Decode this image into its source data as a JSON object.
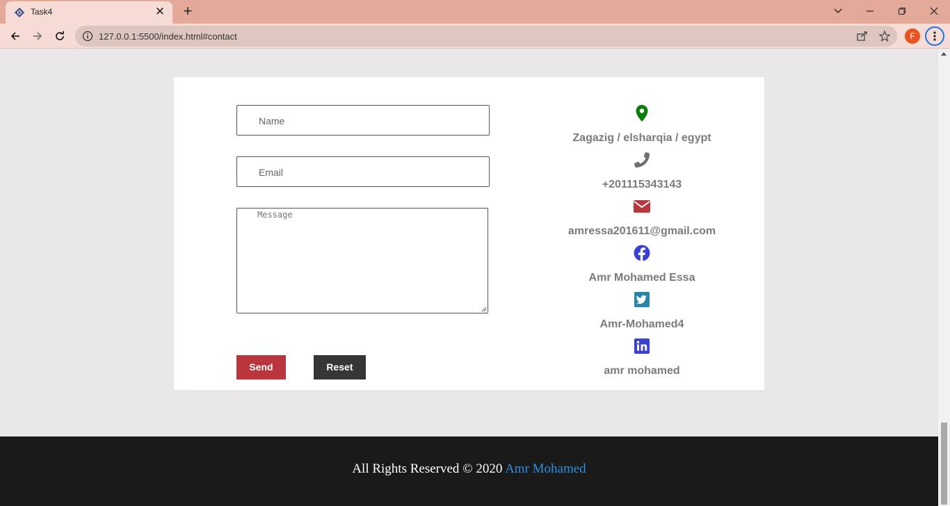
{
  "browser": {
    "tab_title": "Task4",
    "url": "127.0.0.1:5500/index.html#contact",
    "profile_initial": "F"
  },
  "form": {
    "name_placeholder": "Name",
    "email_placeholder": "Email",
    "message_placeholder": "Message",
    "send_label": "Send",
    "reset_label": "Reset"
  },
  "contact": [
    {
      "icon": "location-pin-icon",
      "text": "Zagazig / elsharqia / egypt",
      "color": "#0a7d0a"
    },
    {
      "icon": "phone-icon",
      "text": "+201115343143",
      "color": "#6f6f6f"
    },
    {
      "icon": "envelope-icon",
      "text": "amressa201611@gmail.com",
      "color": "#b9373c"
    },
    {
      "icon": "facebook-icon",
      "text": "Amr Mohamed Essa",
      "color": "#3b3fd6"
    },
    {
      "icon": "twitter-icon",
      "text": "Amr-Mohamed4",
      "color": "#2a86a8"
    },
    {
      "icon": "linkedin-icon",
      "text": "amr mohamed",
      "color": "#3b3fd6"
    }
  ],
  "footer": {
    "text": "All Rights Reserved © 2020",
    "link": "Amr Mohamed"
  }
}
